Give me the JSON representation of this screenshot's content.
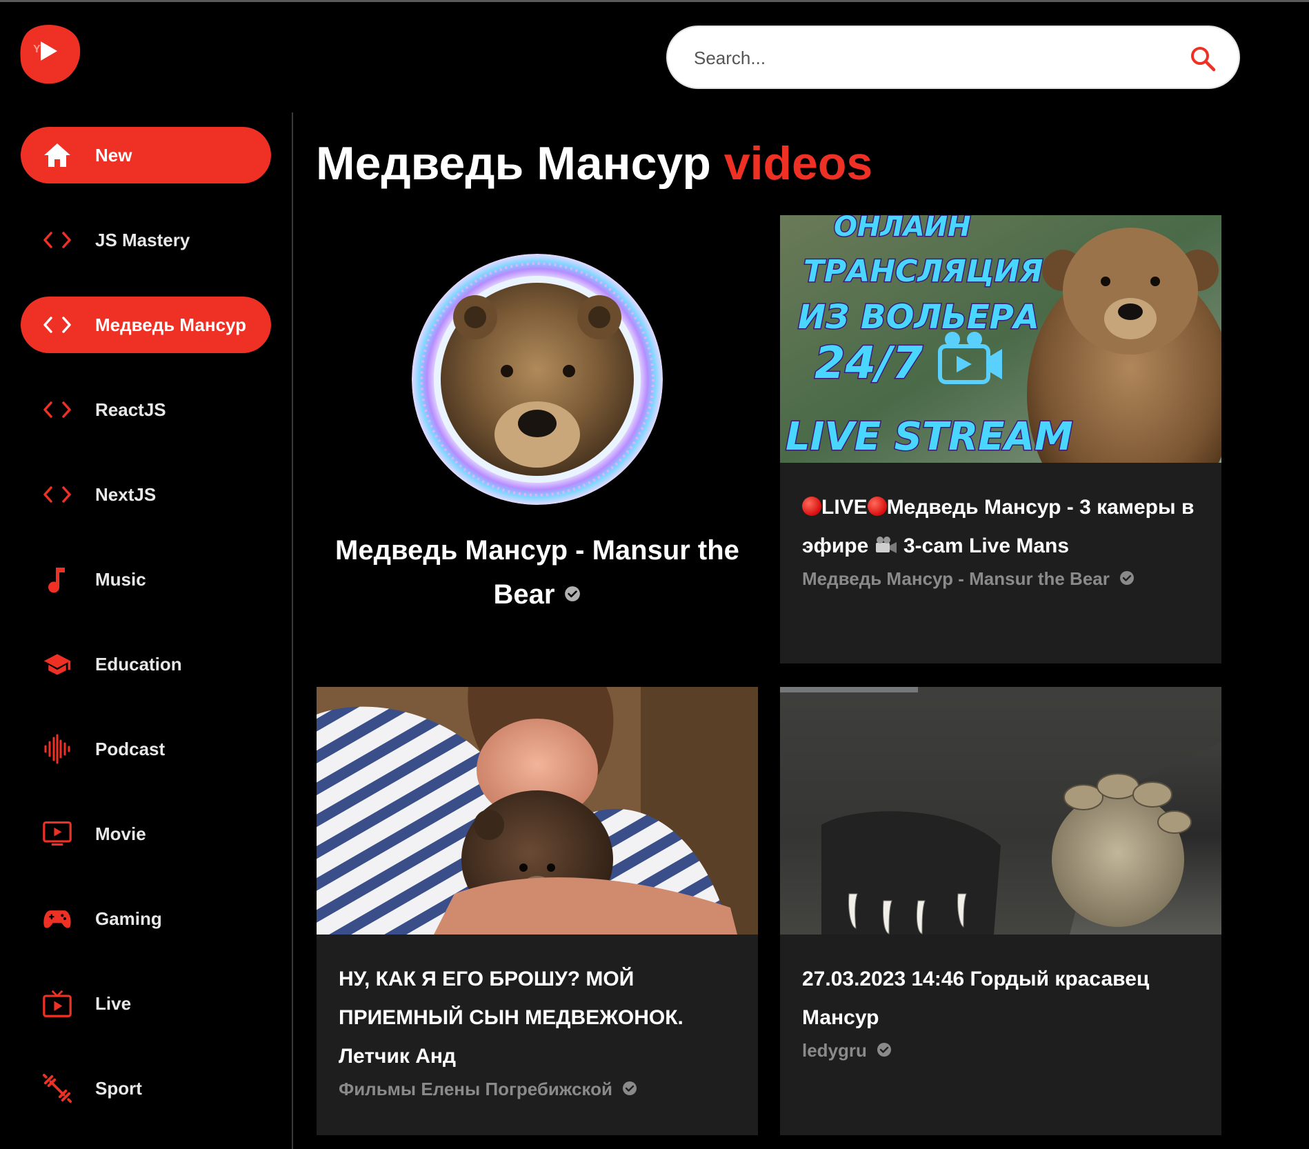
{
  "logo": {
    "text": "YT",
    "icon": "play-icon",
    "color": "#ee3124"
  },
  "search": {
    "placeholder": "Search...",
    "icon": "search-icon"
  },
  "sidebar": {
    "items": [
      {
        "label": "New",
        "icon": "home-icon",
        "active": true
      },
      {
        "label": "JS Mastery",
        "icon": "code-icon",
        "active": false
      },
      {
        "label": "Медведь Мансур",
        "icon": "code-icon",
        "active": true
      },
      {
        "label": "ReactJS",
        "icon": "code-icon",
        "active": false
      },
      {
        "label": "NextJS",
        "icon": "code-icon",
        "active": false
      },
      {
        "label": "Music",
        "icon": "music-note-icon",
        "active": false
      },
      {
        "label": "Education",
        "icon": "graduation-cap-icon",
        "active": false
      },
      {
        "label": "Podcast",
        "icon": "soundwave-icon",
        "active": false
      },
      {
        "label": "Movie",
        "icon": "tv-play-icon",
        "active": false
      },
      {
        "label": "Gaming",
        "icon": "gamepad-icon",
        "active": false
      },
      {
        "label": "Live",
        "icon": "live-tv-icon",
        "active": false
      },
      {
        "label": "Sport",
        "icon": "dumbbell-icon",
        "active": false
      }
    ]
  },
  "main": {
    "title": "Медведь Мансур",
    "title_accent": "videos",
    "channel": {
      "name": "Медведь Мансур - Mansur the Bear",
      "verified": true
    },
    "videos": [
      {
        "title_parts": [
          "LIVE",
          "Медведь Мансур - 3 камеры в эфире",
          "3-cam Live Mans"
        ],
        "thumb_text": [
          "ОНЛАЙН",
          "ТРАНСЛЯЦИЯ",
          "ИЗ ВОЛЬЕРА",
          "24/7",
          "LIVE STREAM"
        ],
        "channel": "Медведь Мансур - Mansur the Bear",
        "verified": true
      },
      {
        "title": "НУ, КАК Я ЕГО БРОШУ? МОЙ ПРИЕМНЫЙ СЫН МЕДВЕЖОНОК. Летчик Анд",
        "channel": "Фильмы Елены Погребижской",
        "verified": true
      },
      {
        "title": "27.03.2023 14:46 Гордый красавец Мансур",
        "channel": "ledygru",
        "verified": true
      }
    ]
  },
  "colors": {
    "accent": "#ee3124",
    "background": "#000000",
    "card": "#1e1e1e",
    "muted_text": "#8a8a8a"
  }
}
